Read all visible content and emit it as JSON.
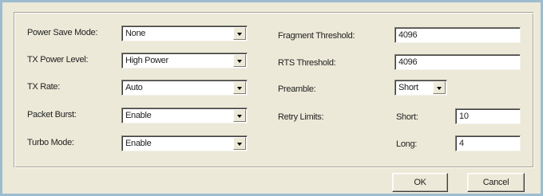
{
  "left_settings": {
    "power_save_mode": {
      "label": "Power Save Mode:",
      "value": "None"
    },
    "tx_power_level": {
      "label": "TX Power Level:",
      "value": "High Power"
    },
    "tx_rate": {
      "label": "TX Rate:",
      "value": "Auto"
    },
    "packet_burst": {
      "label": "Packet Burst:",
      "value": "Enable"
    },
    "turbo_mode": {
      "label": "Turbo Mode:",
      "value": "Enable"
    }
  },
  "right_settings": {
    "fragment_threshold": {
      "label": "Fragment Threshold:",
      "value": "4096"
    },
    "rts_threshold": {
      "label": "RTS Threshold:",
      "value": "4096"
    },
    "preamble": {
      "label": "Preamble:",
      "value": "Short"
    },
    "retry_limits": {
      "label": "Retry Limits:",
      "short_label": "Short:",
      "short_value": "10",
      "long_label": "Long:",
      "long_value": "4"
    }
  },
  "buttons": {
    "ok": "OK",
    "cancel": "Cancel"
  },
  "icons": {
    "dropdown": "chevron-down-icon"
  },
  "colors": {
    "dialog_background": "#ece9d8",
    "window_border": "#9dbcd0",
    "field_background": "#ffffff"
  }
}
